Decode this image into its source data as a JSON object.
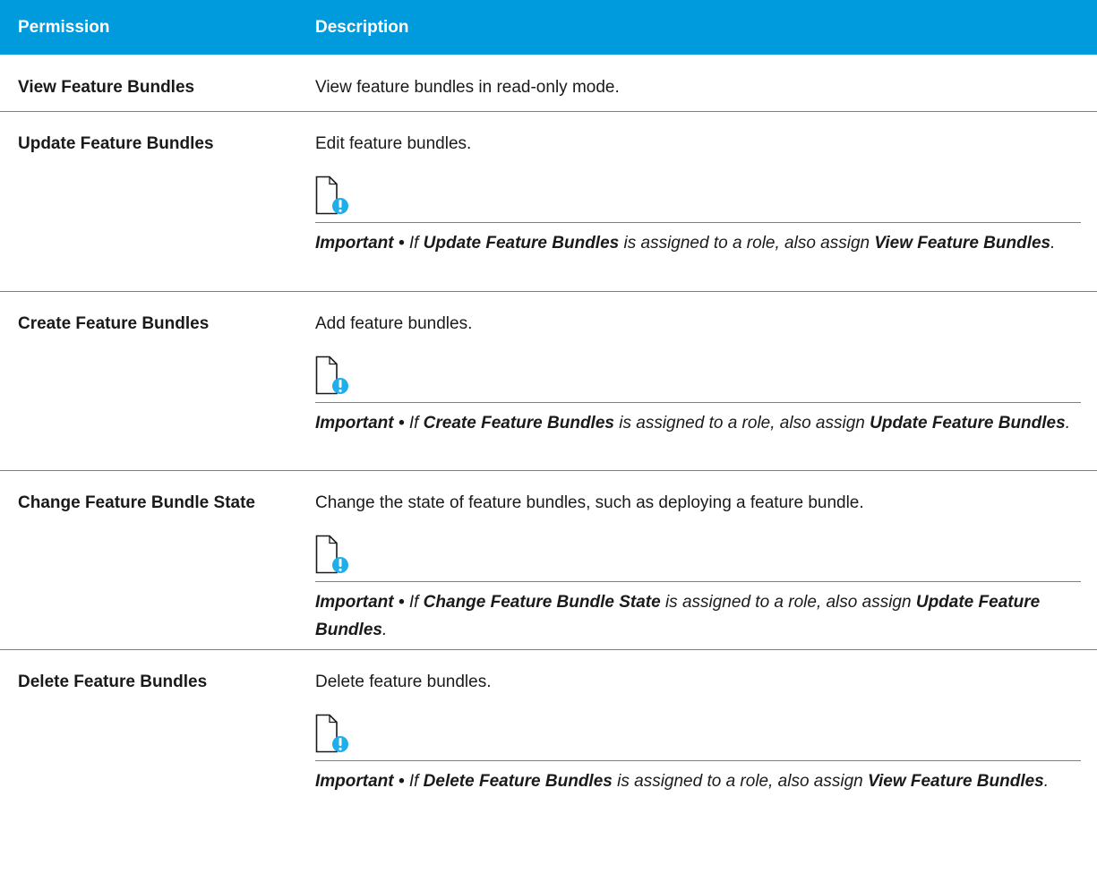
{
  "header": {
    "permission": "Permission",
    "description": "Description"
  },
  "colors": {
    "header_bg": "#009bdd",
    "header_text": "#ffffff",
    "rule": "#7f7f7f",
    "icon_fill": "#1eaeea"
  },
  "rows": [
    {
      "permission": "View Feature Bundles",
      "description": "View feature bundles in read-only mode."
    },
    {
      "permission": "Update Feature Bundles",
      "description": "Edit feature bundles.",
      "note": {
        "icon": "important-note-icon",
        "label": "Important",
        "sep": " • ",
        "if": "If ",
        "subject": "Update Feature Bundles",
        "mid": " is assigned to a role, also assign ",
        "target": "View Feature Bundles",
        "end": "."
      }
    },
    {
      "permission": "Create Feature Bundles",
      "description": "Add feature bundles.",
      "note": {
        "icon": "important-note-icon",
        "label": "Important",
        "sep": " • ",
        "if": "If ",
        "subject": "Create Feature Bundles",
        "mid": " is assigned to a role, also assign ",
        "target": "Update Feature Bundles",
        "end": "."
      }
    },
    {
      "permission": "Change Feature Bundle State",
      "description": "Change the state of feature bundles, such as deploying a feature bundle.",
      "note": {
        "icon": "important-note-icon",
        "label": "Important",
        "sep": " • ",
        "if": "If ",
        "subject": "Change Feature Bundle State",
        "mid": " is assigned to a role, also assign ",
        "target": "Update Feature Bundles",
        "end": "."
      }
    },
    {
      "permission": "Delete Feature Bundles",
      "description": "Delete feature bundles.",
      "note": {
        "icon": "important-note-icon",
        "label": "Important",
        "sep": " • ",
        "if": "If ",
        "subject": "Delete Feature Bundles",
        "mid": " is assigned to a role, also assign ",
        "target": "View Feature Bundles",
        "end": "."
      }
    }
  ]
}
